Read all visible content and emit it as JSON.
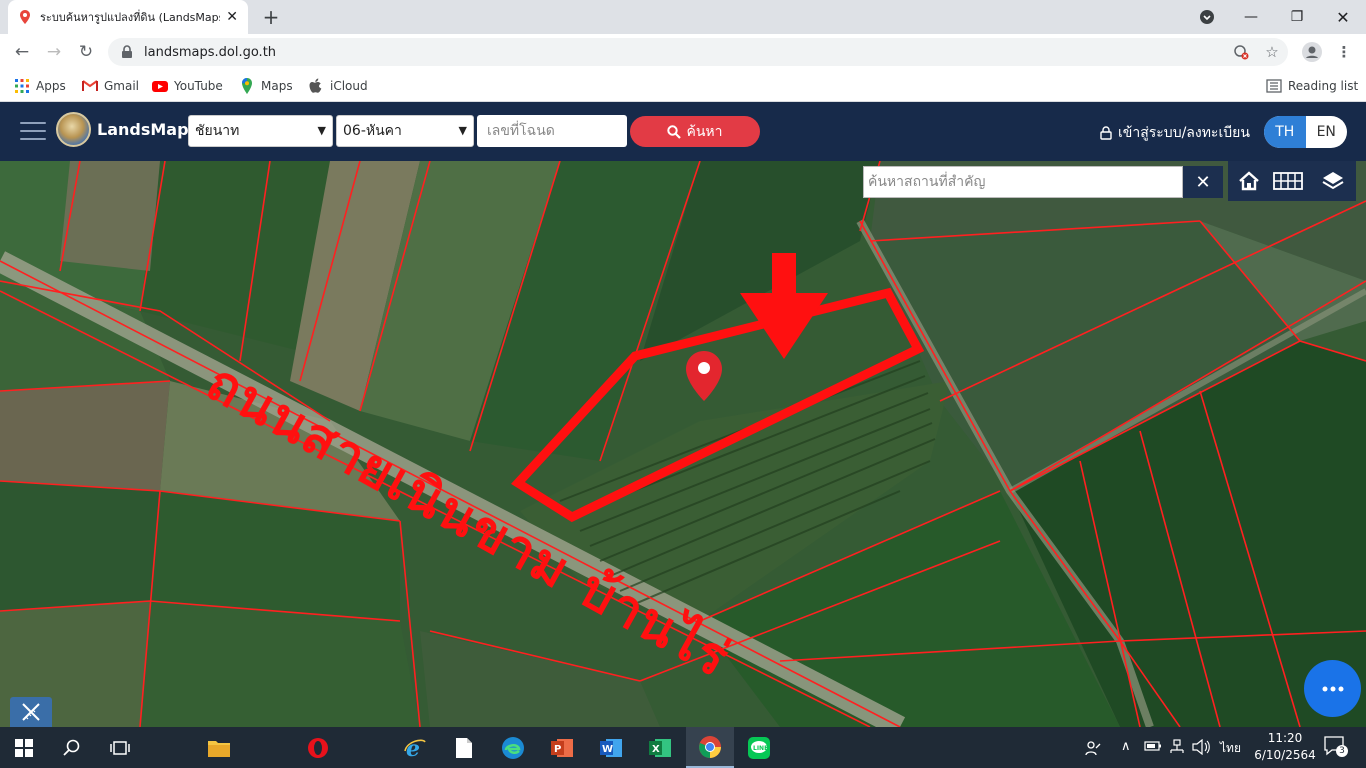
{
  "browser": {
    "tab_title": "ระบบค้นหารูปแปลงที่ดิน (LandsMaps",
    "url": "landsmaps.dol.go.th",
    "bookmarks": [
      {
        "label": "Apps",
        "icon": "apps-grid-icon"
      },
      {
        "label": "Gmail",
        "icon": "gmail-icon"
      },
      {
        "label": "YouTube",
        "icon": "youtube-icon"
      },
      {
        "label": "Maps",
        "icon": "maps-icon"
      },
      {
        "label": "iCloud",
        "icon": "apple-icon"
      }
    ],
    "reading_list": "Reading list"
  },
  "app": {
    "brand": "LandsMaps",
    "province": "ชัยนาท",
    "district": "06-หันคา",
    "deed_placeholder": "เลขที่โฉนด",
    "search_label": "ค้นหา",
    "login_label": "เข้าสู่ระบบ/ลงทะเบียน",
    "lang_th": "TH",
    "lang_en": "EN"
  },
  "map": {
    "place_search_placeholder": "ค้นหาสถานที่สำคัญ",
    "clear_label": "✕",
    "road_annotation": "ถนนสายเนินขาม บ้านไร่",
    "colors": {
      "parcel_line": "#ff2020",
      "annotation": "#ff1010",
      "pin": "#e3262e"
    }
  },
  "taskbar": {
    "time": "11:20",
    "date": "6/10/2564",
    "lang_indicator": "ไทย",
    "notifications": "3"
  }
}
